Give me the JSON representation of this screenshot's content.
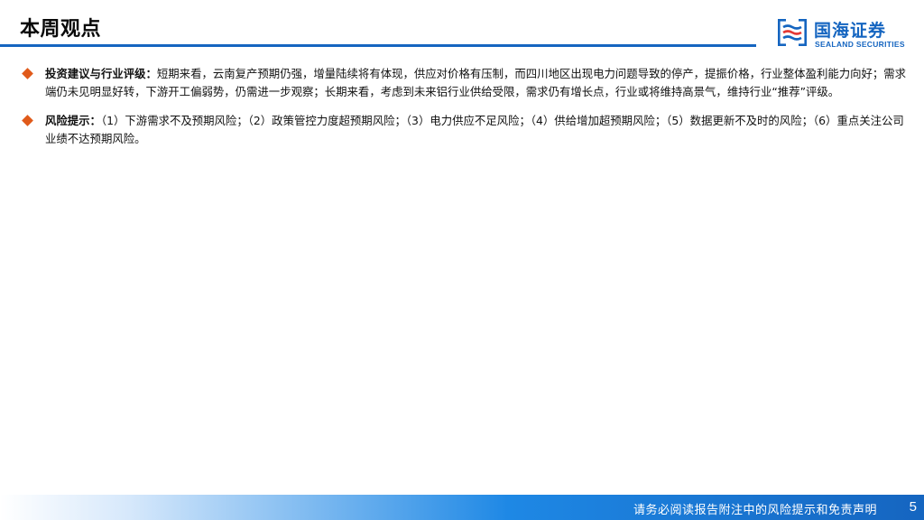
{
  "page": {
    "title": "本周观点"
  },
  "logo": {
    "name_cn": "国海证券",
    "name_en": "SEALAND SECURITIES"
  },
  "bullets": [
    {
      "label": "投资建议与行业评级：",
      "text": "短期来看，云南复产预期仍强，增量陆续将有体现，供应对价格有压制，而四川地区出现电力问题导致的停产，提振价格，行业整体盈利能力向好；需求端仍未见明显好转，下游开工偏弱势，仍需进一步观察；长期来看，考虑到未来铝行业供给受限，需求仍有增长点，行业或将维持高景气，维持行业“推荐”评级。"
    },
    {
      "label": "风险提示：",
      "text": "（1）下游需求不及预期风险；（2）政策管控力度超预期风险；（3）电力供应不足风险；（4）供给增加超预期风险；（5）数据更新不及时的风险；（6）重点关注公司业绩不达预期风险。"
    }
  ],
  "footer": {
    "disclaimer": "请务必阅读报告附注中的风险提示和免责声明",
    "page_number": "5"
  },
  "colors": {
    "brand_blue": "#1565c0",
    "bullet_orange": "#e05a1a"
  }
}
